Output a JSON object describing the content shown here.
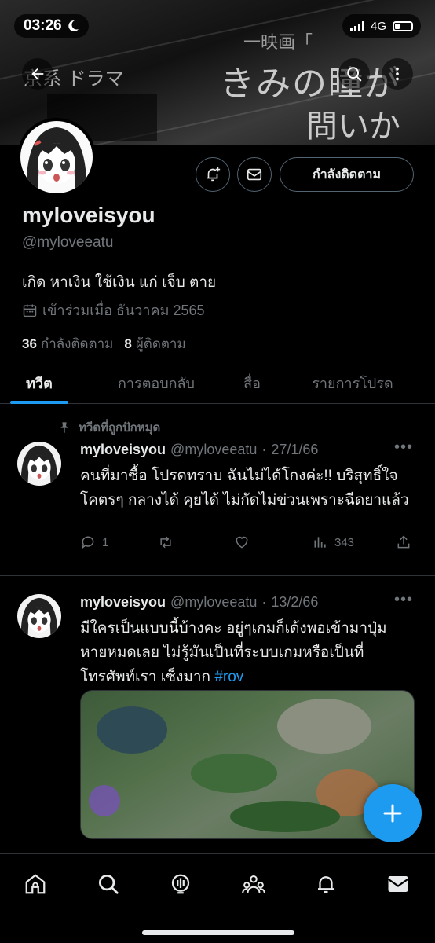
{
  "status_bar": {
    "time": "03:26",
    "network": "4G"
  },
  "profile": {
    "display_name": "myloveisyou",
    "handle": "@myloveeatu",
    "bio": "เกิด หาเงิน ใช้เงิน แก่ เจ็บ ตาย",
    "joined": "เข้าร่วมเมื่อ ธันวาคม 2565",
    "following_count": "36",
    "following_label": "กำลังติดตาม",
    "followers_count": "8",
    "followers_label": "ผู้ติดตาม",
    "follow_button_label": "กำลังติดตาม"
  },
  "tabs": [
    {
      "label": "ทวีต",
      "active": true
    },
    {
      "label": "การตอบกลับ",
      "active": false
    },
    {
      "label": "สื่อ",
      "active": false
    },
    {
      "label": "รายการโปรด",
      "active": false
    }
  ],
  "pinned_label": "ทวีตที่ถูกปักหมุด",
  "tweets": [
    {
      "name": "myloveisyou",
      "handle": "@myloveeatu",
      "date": "27/1/66",
      "text": "คนที่มาซื้อ โปรดทราบ ฉันไม่ได้โกงค่ะ!! บริสุทธิ์ใจ โคตรๆ กลางได้ คุยได้ ไม่กัดไม่ข่วนเพราะฉีดยาแล้ว",
      "replies": "1",
      "views": "343"
    },
    {
      "name": "myloveisyou",
      "handle": "@myloveeatu",
      "date": "13/2/66",
      "text": "มีใครเป็นแบบนี้บ้างคะ อยู่ๆเกมก็เด้งพอเข้ามาปุ่มหายหมดเลย ไม่รู้มันเป็นที่ระบบเกมหรือเป็นที่โทรศัพท์เรา เซ็งมาก",
      "hashtag": "#rov"
    }
  ],
  "colors": {
    "accent": "#1d9bf0",
    "background": "#000000",
    "text_primary": "#e7e9ea",
    "text_secondary": "#71767b",
    "border": "#2f3336"
  },
  "icons": {
    "nav": [
      "back-arrow-icon",
      "search-icon",
      "more-icon"
    ],
    "bottom_nav": [
      "home-icon",
      "search-icon",
      "spaces-icon",
      "communities-icon",
      "notifications-icon",
      "messages-icon"
    ]
  }
}
